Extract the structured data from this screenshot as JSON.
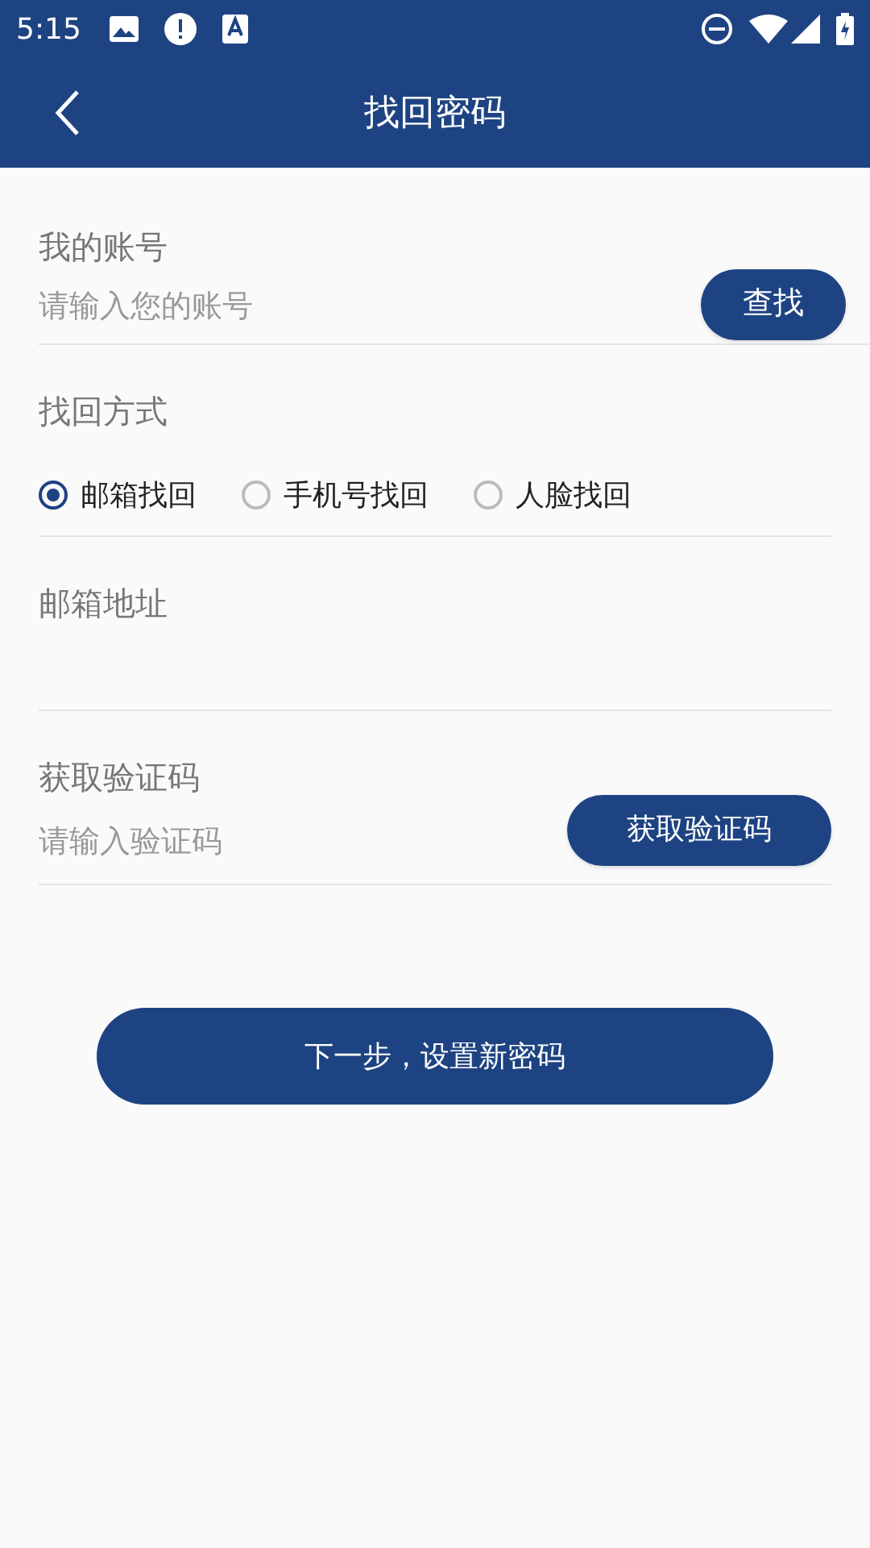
{
  "status_bar": {
    "time": "5:15"
  },
  "header": {
    "title": "找回密码"
  },
  "account": {
    "label": "我的账号",
    "placeholder": "请输入您的账号",
    "button": "查找"
  },
  "method": {
    "label": "找回方式",
    "options": [
      {
        "label": "邮箱找回",
        "selected": true
      },
      {
        "label": "手机号找回",
        "selected": false
      },
      {
        "label": "人脸找回",
        "selected": false
      }
    ]
  },
  "email": {
    "label": "邮箱地址"
  },
  "code": {
    "label": "获取验证码",
    "placeholder": "请输入验证码",
    "button": "获取验证码"
  },
  "next_button": "下一步，设置新密码"
}
